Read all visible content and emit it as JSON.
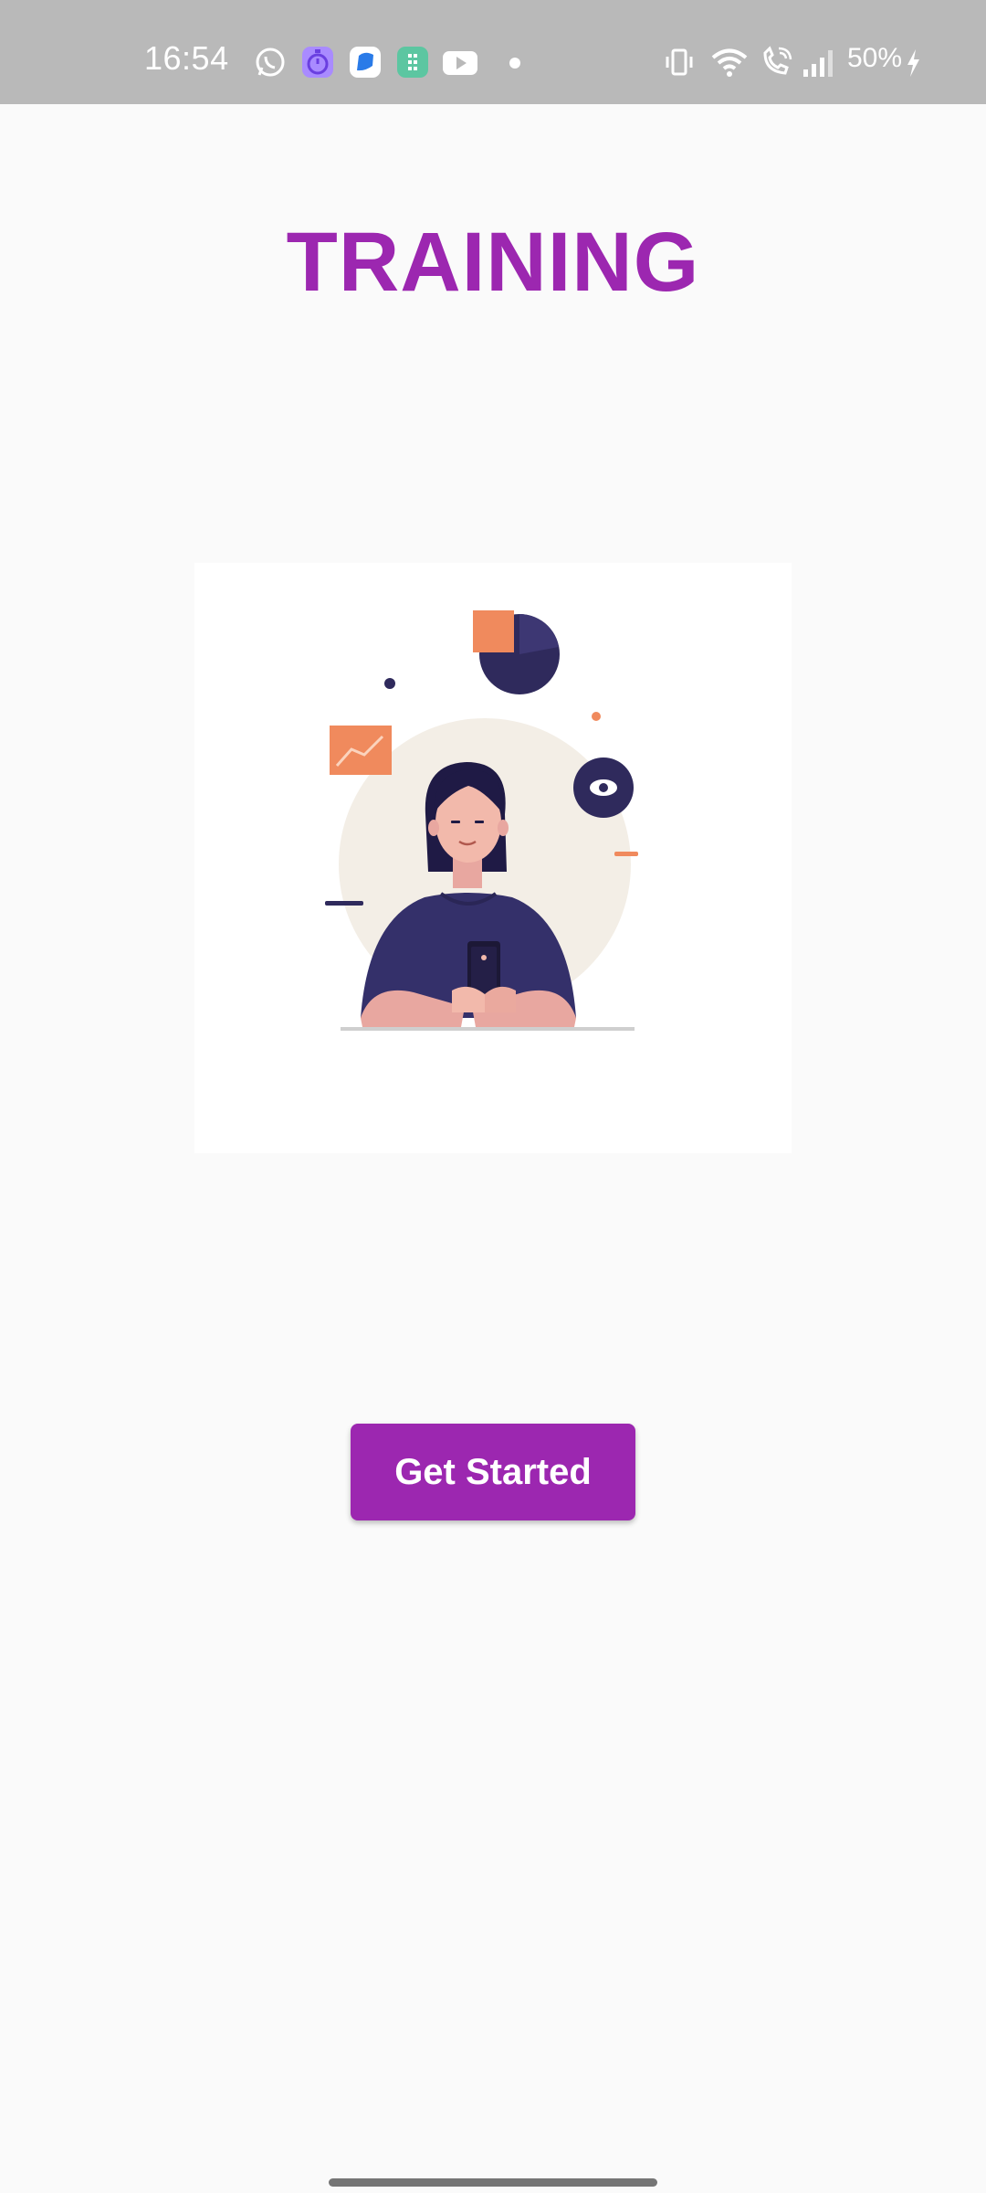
{
  "status_bar": {
    "time": "16:54",
    "battery": "50%",
    "notification_icons": [
      "whatsapp-icon",
      "timer-app-icon",
      "messenger-app-icon",
      "green-app-icon",
      "youtube-icon",
      "dot-icon"
    ],
    "system_icons": [
      "vibrate-icon",
      "wifi-icon",
      "wifi-calling-icon",
      "signal-icon",
      "charging-icon"
    ]
  },
  "page": {
    "title": "TRAINING",
    "illustration": "woman-with-phone-illustration"
  },
  "actions": {
    "get_started_label": "Get Started"
  },
  "colors": {
    "accent": "#9c27b0",
    "status_bar": "#b9b9b9",
    "background": "#fafafa",
    "illustration_navy": "#2f2a5c",
    "illustration_orange": "#f08a5d"
  }
}
